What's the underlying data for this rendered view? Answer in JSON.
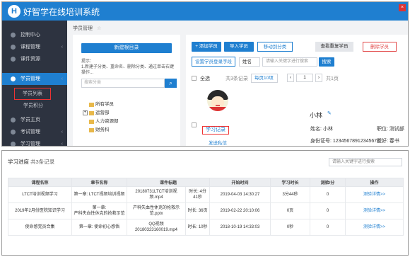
{
  "app": {
    "title": "好智学在线培训系统",
    "logo_letter": "H",
    "close_glyph": "×"
  },
  "sidebar": {
    "items": [
      {
        "label": "控制中心",
        "icon": "dashboard-icon",
        "arrow": ""
      },
      {
        "label": "课程管理",
        "icon": "book-icon",
        "arrow": "‹"
      },
      {
        "label": "课件资源",
        "icon": "folder-icon",
        "arrow": ""
      },
      {
        "label": "学员管理",
        "icon": "user-icon",
        "arrow": "‹"
      }
    ],
    "subitems": [
      "学员列表",
      "学员积分"
    ],
    "more_items": [
      {
        "label": "学员主页",
        "icon": "home-icon",
        "arrow": ""
      },
      {
        "label": "考试管理",
        "icon": "exam-icon",
        "arrow": "‹"
      },
      {
        "label": "学习管理",
        "icon": "study-icon",
        "arrow": "‹"
      }
    ]
  },
  "breadcrumb": {
    "label": "学员管理",
    "star": "☆"
  },
  "category_panel": {
    "new_button": "新建根目录",
    "tip": "提示：\n1.新建子分类、重命名、删除分类、通过单击右键操作...",
    "search_placeholder": "搜索分类",
    "tree": [
      {
        "label": "所有学员",
        "expand": ""
      },
      {
        "label": "运营部",
        "expand": "+"
      },
      {
        "label": "人力资源部",
        "expand": ""
      },
      {
        "label": "财务科",
        "expand": ""
      }
    ]
  },
  "toolbar": {
    "add_student": "+ 添加学员",
    "import_students": "导入学员",
    "move_category": "移动到分类",
    "view_dup": "查看重复学员",
    "delete_student": "删除学员",
    "set_login_field": "设置学员登录字段",
    "field_select": "姓名",
    "keyword_placeholder": "请输入关键字进行搜索",
    "search_button": "搜索"
  },
  "list": {
    "select_all": "全选",
    "record_count": "共3条记录",
    "per_page": "每页10项",
    "page": "1",
    "total_pages": "共1页"
  },
  "student": {
    "name": "小林",
    "name_label": "姓名: 小林",
    "position": "职位: 测试部",
    "id_card": "身份证号: 123456789123456​78",
    "org": "盟好: 春书",
    "study_record": "学习记录",
    "send_message": "发送私信"
  },
  "records": {
    "title": "学习进度",
    "count": "共3条记录",
    "search_placeholder": "请输入关键字进行搜索",
    "headers": [
      "课程名称",
      "章节名称",
      "课件标题",
      "",
      "开始时间",
      "学习时长",
      "测验/分",
      "操作"
    ],
    "rows": [
      [
        "LTCT培训视频学习",
        "第一章: LTCT视频培训视频",
        "20180731LTCT培训视频.mp4",
        "时长: 4分41秒",
        "2019-04-03 14:30:27",
        "3分44秒",
        "0",
        "测验详情>>"
      ],
      [
        "2019年2月份医院知识学习",
        "第一章:\n产科失血性休克的抢救示范",
        "产科失血性休克的抢救示范.pptx",
        "时长: 36页",
        "2019-02-22 20:10:06",
        "0页",
        "0",
        "测验详情>>"
      ],
      [
        "使命感党员合集",
        "第一章: 使命初心感悟",
        "QQ视频20180323160019.mp4",
        "时长: 10秒",
        "2018-10-19 14:33:03",
        "0秒",
        "0",
        "测验详情>>"
      ]
    ]
  }
}
